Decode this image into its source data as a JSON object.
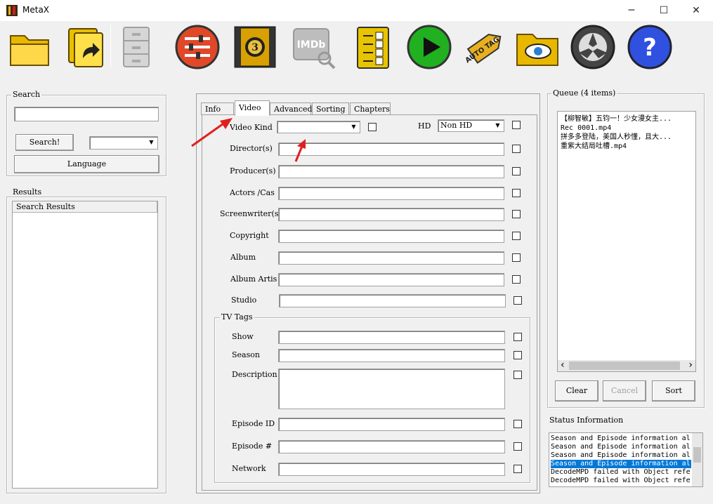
{
  "window": {
    "title": "MetaX",
    "minimize_glyph": "─",
    "maximize_glyph": "☐",
    "close_glyph": "✕"
  },
  "toolbar": [
    {
      "name": "open-file-folder-icon",
      "interactable": true
    },
    {
      "name": "batch-load-icon",
      "interactable": true
    },
    {
      "name": "file-cabinet-icon",
      "interactable": false
    },
    {
      "name": "settings-sliders-icon",
      "interactable": true
    },
    {
      "name": "film-countdown-icon",
      "interactable": true
    },
    {
      "name": "imdb-search-icon",
      "interactable": false,
      "text": "IMDb"
    },
    {
      "name": "checklist-icon",
      "interactable": true
    },
    {
      "name": "play-icon",
      "interactable": true
    },
    {
      "name": "auto-tag-icon",
      "interactable": true,
      "text": "AUTO TAG"
    },
    {
      "name": "watch-folder-icon",
      "interactable": true
    },
    {
      "name": "reel-icon",
      "interactable": true
    },
    {
      "name": "help-icon",
      "interactable": true
    }
  ],
  "search": {
    "group_label": "Search",
    "input_value": "",
    "search_button": "Search!",
    "source_value": "",
    "language_button": "Language"
  },
  "results": {
    "group_label": "Results",
    "column_header": "Search Results"
  },
  "tabs": [
    "Info",
    "Video",
    "Advanced",
    "Sorting",
    "Chapters"
  ],
  "video_form": {
    "video_kind_label": "Video Kind",
    "video_kind_value": "",
    "hd_label": "HD",
    "hd_value": "Non HD",
    "fields": [
      {
        "label": "Director(s)",
        "value": ""
      },
      {
        "label": "Producer(s)",
        "value": ""
      },
      {
        "label": "Actors /Cas",
        "value": ""
      },
      {
        "label": "Screenwriter(s",
        "value": ""
      },
      {
        "label": "Copyright",
        "value": ""
      },
      {
        "label": "Album",
        "value": ""
      },
      {
        "label": "Album Artis",
        "value": ""
      },
      {
        "label": "Studio",
        "value": ""
      }
    ],
    "tv_group_label": "TV Tags",
    "tv_fields": [
      {
        "label": "Show",
        "value": ""
      },
      {
        "label": "Season",
        "value": ""
      },
      {
        "label": "Description",
        "value": ""
      },
      {
        "label": "Episode ID",
        "value": ""
      },
      {
        "label": "Episode #",
        "value": ""
      },
      {
        "label": "Network",
        "value": ""
      }
    ]
  },
  "queue": {
    "group_label": "Queue (4 items)",
    "items": [
      "【柳智敏】五钧一！少女漫女主...",
      "Rec 0001.mp4",
      "拼多多登陆，美国人秒懂，且大...",
      "重紫大结局吐槽.mp4"
    ],
    "scroll_left": "‹",
    "scroll_right": "›",
    "clear_button": "Clear",
    "cancel_button": "Cancel",
    "sort_button": "Sort"
  },
  "status": {
    "group_label": "Status Information",
    "lines": [
      "Season and Episode information al",
      "Season and Episode information al",
      "Season and Episode information al",
      "Season and Episode information al",
      "DecodeMPD failed with Object refe",
      "DecodeMPD failed with Object refe"
    ],
    "selected_index": 3
  },
  "colors": {
    "selection": "#0078d7",
    "annotation_arrow": "#e02020"
  }
}
